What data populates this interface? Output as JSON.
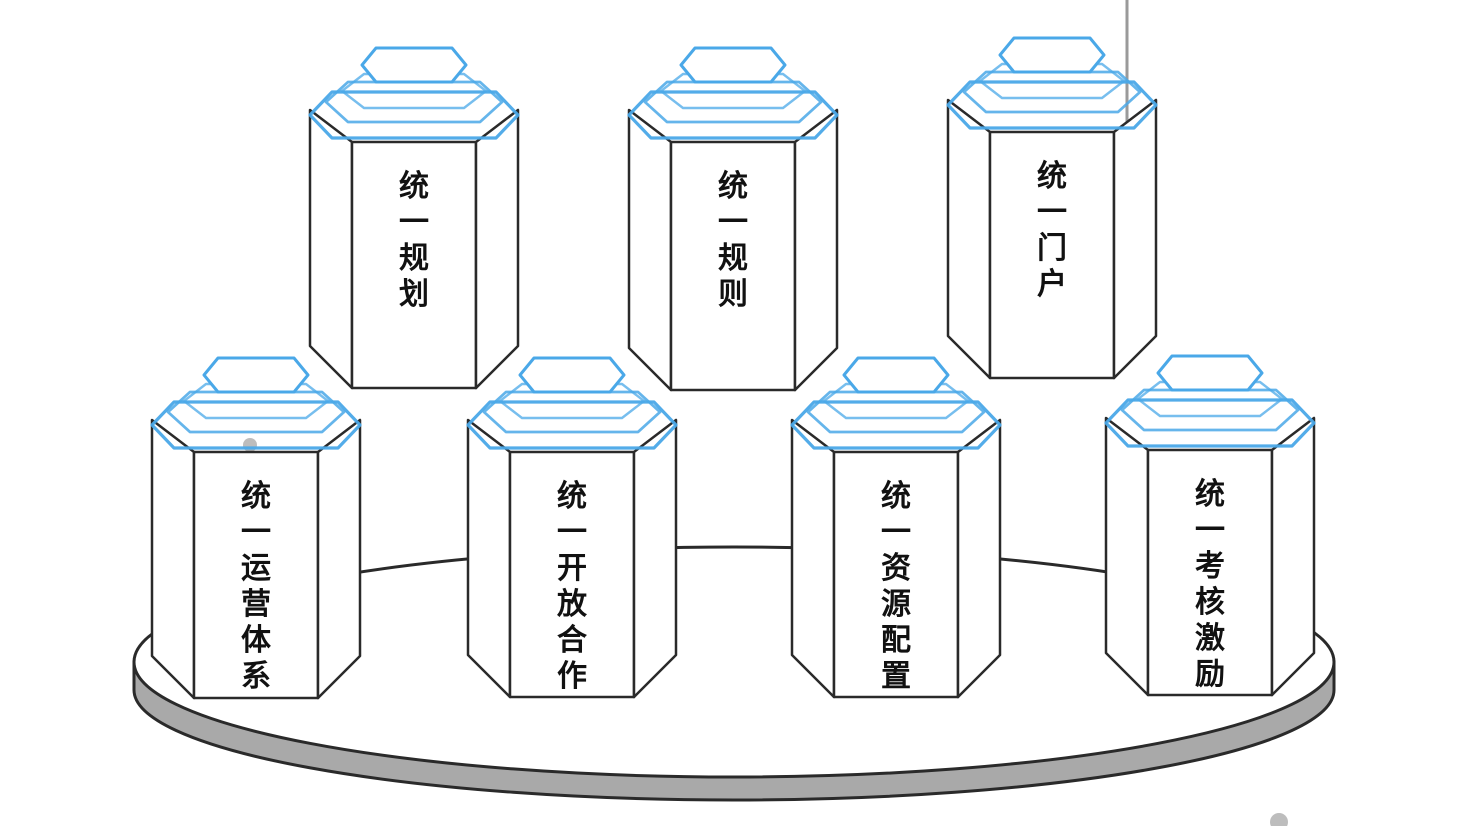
{
  "diagram": {
    "pillars_top": [
      {
        "id": "planning",
        "label": "统一规划"
      },
      {
        "id": "rules",
        "label": "统一规则"
      },
      {
        "id": "portal",
        "label": "统一门户"
      }
    ],
    "pillars_bottom": [
      {
        "id": "operations",
        "label": "统一运营体系"
      },
      {
        "id": "cooperation",
        "label": "统一开放合作"
      },
      {
        "id": "resources",
        "label": "统一资源配置"
      },
      {
        "id": "incentive",
        "label": "统一考核激励"
      }
    ],
    "colors": {
      "outline": "#2a2a2a",
      "accent": "#4aa8e8",
      "platform_side": "#a9a9a9",
      "platform_top": "#ffffff"
    }
  }
}
